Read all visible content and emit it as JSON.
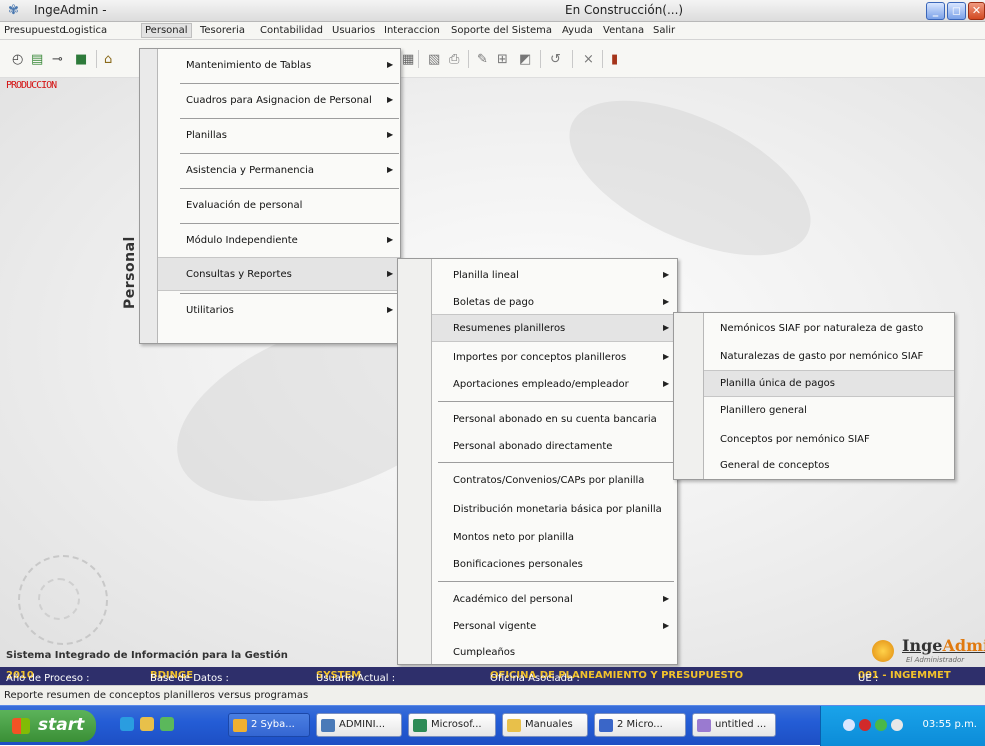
{
  "window": {
    "app_title": "IngeAdmin -",
    "doc_title": "En Construcción(...)",
    "controls": [
      "_",
      "◻",
      "✕"
    ]
  },
  "menubar": {
    "items": [
      "Presupuesto",
      "Logistica",
      "Personal",
      "Tesoreria",
      "Contabilidad",
      "Usuarios",
      "Interaccion",
      "Soporte del Sistema",
      "Ayuda",
      "Ventana",
      "Salir"
    ],
    "active": "Personal"
  },
  "toolbar": {
    "icons": [
      "clock-icon",
      "calendar-icon",
      "key-icon",
      "green-box-icon",
      "bank-icon",
      "save-icon",
      "grid-icon",
      "print-icon",
      "edit-icon",
      "table-icon",
      "chart-icon",
      "undo-icon",
      "close-icon",
      "exit-door-icon"
    ]
  },
  "env_label": "PRODUCCION",
  "personal_menu": {
    "side_label": "Personal",
    "items": [
      {
        "label": "Mantenimiento de Tablas",
        "submenu": true
      },
      {
        "label": "Cuadros para Asignacion de Personal",
        "submenu": true
      },
      {
        "label": "Planillas",
        "submenu": true
      },
      {
        "label": "Asistencia y Permanencia",
        "submenu": true
      },
      {
        "label": "Evaluación de personal",
        "submenu": false
      },
      {
        "label": "Módulo Independiente",
        "submenu": true
      },
      {
        "label": "Consultas y Reportes",
        "submenu": true
      },
      {
        "label": "Utilitarios",
        "submenu": true
      }
    ],
    "highlighted": "Consultas y Reportes"
  },
  "consultas_menu": {
    "items": [
      {
        "label": "Planilla lineal",
        "submenu": true
      },
      {
        "label": "Boletas de pago",
        "submenu": true
      },
      {
        "label": "Resumenes planilleros",
        "submenu": true
      },
      {
        "label": "Importes por conceptos planilleros",
        "submenu": true
      },
      {
        "label": "Aportaciones empleado/empleador",
        "submenu": true
      },
      {
        "label": "Personal abonado en su cuenta bancaria",
        "submenu": false
      },
      {
        "label": "Personal abonado directamente",
        "submenu": false
      },
      {
        "label": "Contratos/Convenios/CAPs por planilla",
        "submenu": false
      },
      {
        "label": "Distribución monetaria básica por planilla",
        "submenu": false
      },
      {
        "label": "Montos neto por planilla",
        "submenu": false
      },
      {
        "label": "Bonificaciones personales",
        "submenu": false
      },
      {
        "label": "Académico del personal",
        "submenu": true
      },
      {
        "label": "Personal vigente",
        "submenu": true
      },
      {
        "label": "Cumpleaños",
        "submenu": false
      }
    ],
    "highlighted": "Resumenes planilleros"
  },
  "resumenes_menu": {
    "items": [
      {
        "label": "Nemónicos SIAF por naturaleza de gasto"
      },
      {
        "label": "Naturalezas de gasto por nemónico SIAF"
      },
      {
        "label": "Planilla única de pagos"
      },
      {
        "label": "Planillero general"
      },
      {
        "label": "Conceptos por nemónico SIAF"
      },
      {
        "label": "General de conceptos"
      }
    ],
    "highlighted": "Planilla única de pagos"
  },
  "footer": {
    "sistema": "Sistema Integrado de Información para la Gestión",
    "logo_name_a": "Inge",
    "logo_name_b": "Admin",
    "logo_sub": "El Administrador"
  },
  "statusbar": {
    "anio_label": "Año de Proceso :",
    "anio_value": "2010",
    "bd_label": "Base de Datos :",
    "bd_value": "BDINGE",
    "user_label": "Usuario Actual :",
    "user_value": "SYSTEM",
    "oficina_label": "Oficina Asociada :",
    "oficina_value": "OFICINA DE PLANEAMIENTO Y PRESUPUESTO",
    "ue_label": "UE :",
    "ue_value": "001 - INGEMMET"
  },
  "infobar": {
    "text": "Reporte resumen  de conceptos planilleros versus programas"
  },
  "taskbar": {
    "start": "start",
    "tasks": [
      "2 Syba...",
      "ADMINI...",
      "Microsof...",
      "Manuales",
      "2 Micro...",
      "untitled ..."
    ],
    "clock": "03:55 p.m."
  }
}
